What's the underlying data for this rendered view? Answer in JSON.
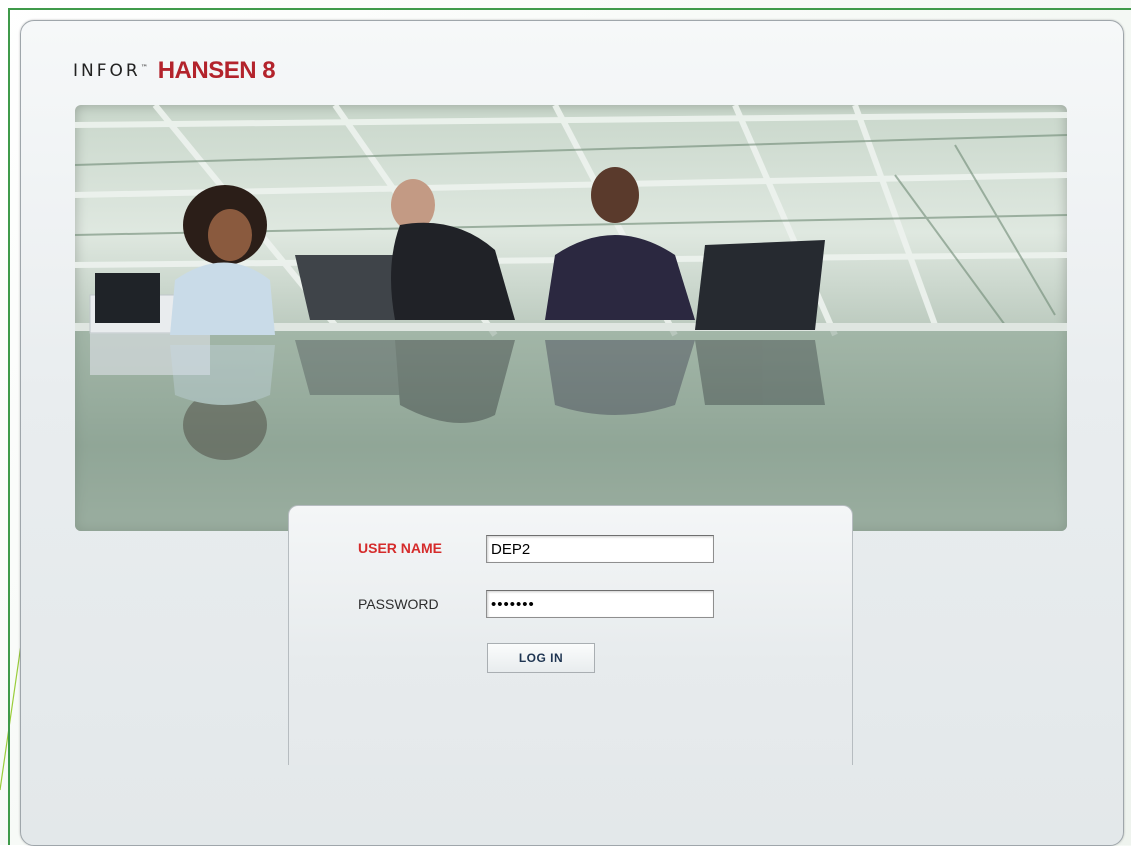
{
  "brand": {
    "infor": "INFOR",
    "hansen": "HANSEN 8"
  },
  "login": {
    "username_label": "USER NAME",
    "username_value": "DEP2",
    "password_label": "PASSWORD",
    "password_value": "•••••••",
    "login_button": "LOG IN"
  },
  "colors": {
    "accent_red": "#b3232c",
    "label_red": "#d52b2b",
    "frame_green": "#3f9a4a"
  }
}
